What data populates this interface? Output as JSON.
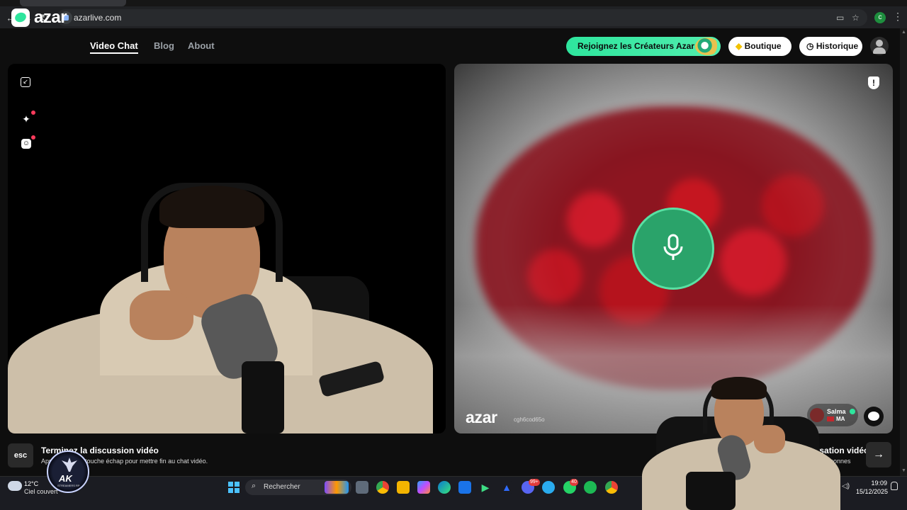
{
  "browser": {
    "url": "azarlive.com",
    "profile_initial": "c"
  },
  "header": {
    "logo_text": "azar",
    "nav": [
      {
        "label": "Video Chat",
        "active": true
      },
      {
        "label": "Blog",
        "active": false
      },
      {
        "label": "About",
        "active": false
      }
    ],
    "creators_cta": "Rejoignez les Créateurs Azar",
    "boutique_label": "Boutique",
    "history_label": "Historique"
  },
  "remote_video": {
    "watermark": "azar",
    "session_id": "cgh6cod65o",
    "peer_name": "Salma",
    "peer_country": "MA"
  },
  "bottom": {
    "esc_key": "esc",
    "end_title": "Terminez la discussion vidéo",
    "end_subtitle": "Appuyez sur la touche échap pour mettre fin au chat vidéo.",
    "next_title": "Conversation vidéo",
    "next_subtitle": "autres personnes"
  },
  "overlay": {
    "logo_text": "AK",
    "logo_tag": "STREAMERS RP"
  },
  "taskbar": {
    "temperature": "12°C",
    "weather": "Ciel couvert",
    "search_placeholder": "Rechercher",
    "badges": {
      "discord": "99+",
      "whatsapp": "40"
    },
    "time": "19:09",
    "date": "15/12/2025"
  },
  "colors": {
    "accent": "#2ee59d",
    "mic_button": "#2aa36a",
    "notification_dot": "#ff3b5c"
  }
}
